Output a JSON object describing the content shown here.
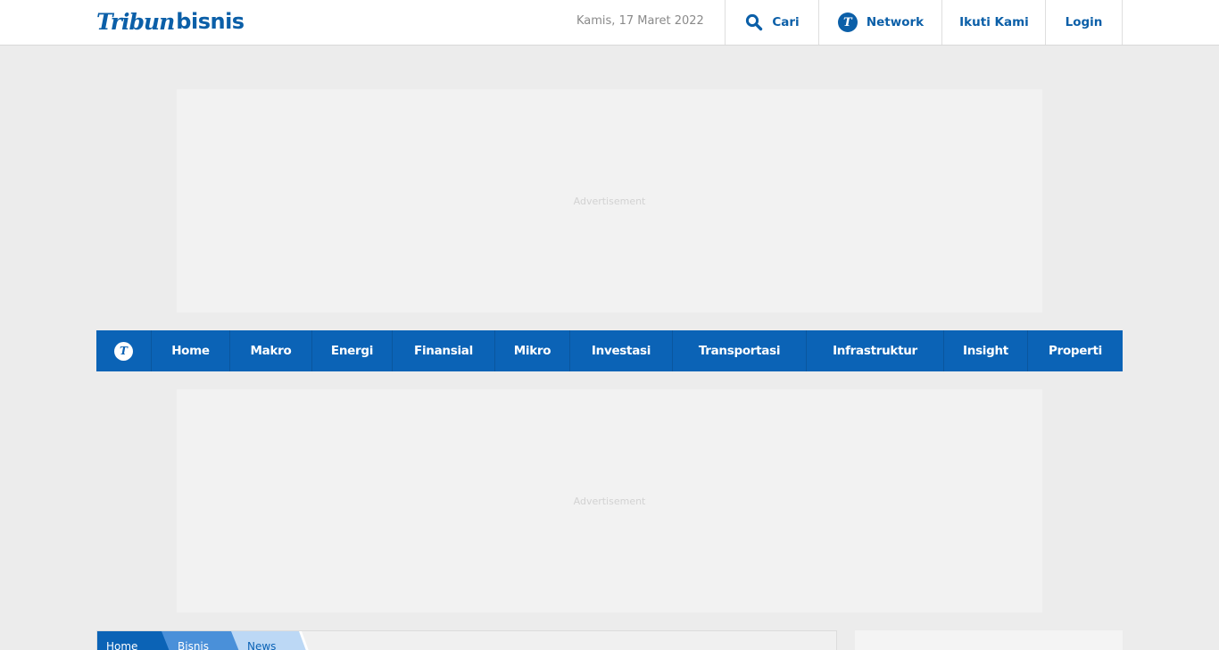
{
  "header": {
    "logo_tribun": "Tribun",
    "logo_bisnis": "bisnis",
    "date": "Kamis, 17 Maret 2022",
    "search_label": "Cari",
    "network_label": "Network",
    "follow_label": "Ikuti Kami",
    "login_label": "Login",
    "network_icon_letter": "T"
  },
  "ads": {
    "top_label": "Advertisement",
    "middle_label": "Advertisement"
  },
  "nav": {
    "home_icon_letter": "T",
    "items": [
      "Home",
      "Makro",
      "Energi",
      "Finansial",
      "Mikro",
      "Investasi",
      "Transportasi",
      "Infrastruktur",
      "Insight",
      "Properti"
    ]
  },
  "breadcrumb": {
    "items": [
      "Home",
      "Bisnis",
      "News"
    ]
  },
  "colors": {
    "brand_blue": "#0b63b6",
    "page_background": "#ececec",
    "ad_background": "#f2f2f2"
  }
}
